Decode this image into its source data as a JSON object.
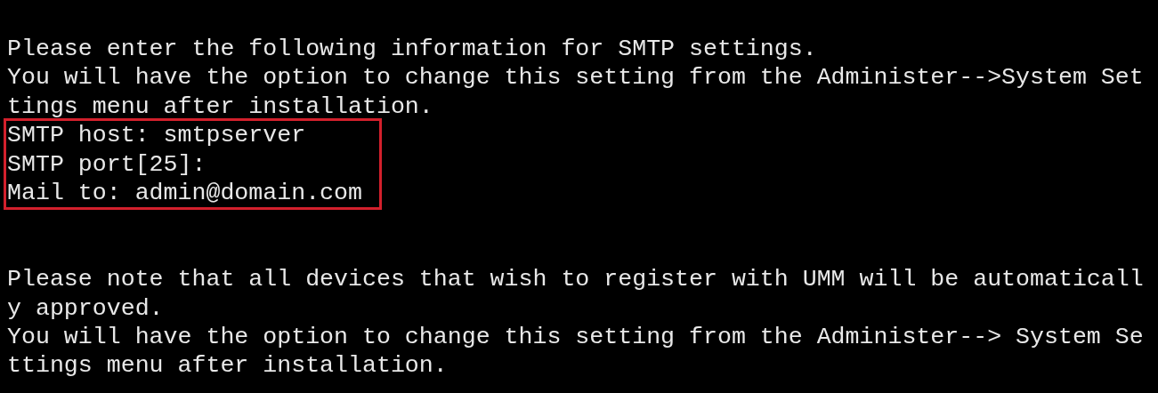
{
  "terminal": {
    "intro_lines": [
      "Please enter the following information for SMTP settings.",
      "You will have the option to change this setting from the Administer-->System Set",
      "tings menu after installation."
    ],
    "highlighted_lines": [
      "SMTP host: smtpserver",
      "SMTP port[25]:",
      "Mail to: admin@domain.com"
    ],
    "notice_lines": [
      "Please note that all devices that wish to register with UMM will be automaticall",
      "y approved.",
      "You will have the option to change this setting from the Administer--> System Se",
      "ttings menu after installation."
    ]
  }
}
